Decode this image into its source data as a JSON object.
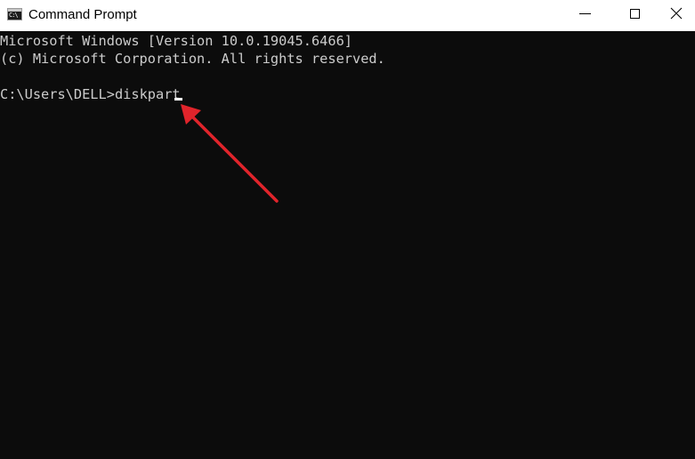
{
  "window": {
    "title": "Command Prompt",
    "icon": "cmd-icon",
    "controls": [
      "minimize-icon",
      "maximize-icon",
      "close-icon"
    ]
  },
  "console": {
    "lines": [
      "Microsoft Windows [Version 10.0.19045.6466]",
      "(c) Microsoft Corporation. All rights reserved."
    ],
    "prompt": "C:\\Users\\DELL>",
    "command": "diskpart"
  },
  "annotation": {
    "type": "arrow",
    "color": "#e0242b"
  },
  "colors": {
    "titlebar_bg": "#ffffff",
    "console_bg": "#0c0c0c",
    "console_text": "#cccccc"
  }
}
